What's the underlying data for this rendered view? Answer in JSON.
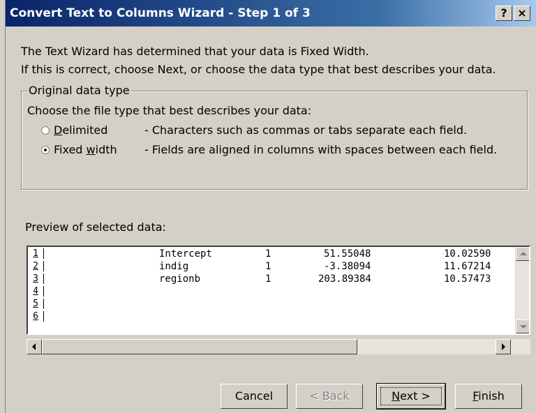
{
  "window": {
    "title": "Convert Text to Columns Wizard - Step 1 of 3",
    "help_label": "?",
    "close_label": "×"
  },
  "intro": {
    "line1": "The Text Wizard has determined that your data is Fixed Width.",
    "line2": "If this is correct, choose Next, or choose the data type that best describes your data."
  },
  "data_type": {
    "group_label": "Original data type",
    "prompt": "Choose the file type that best describes your data:",
    "options": [
      {
        "label_pre": "",
        "label_mnemonic": "D",
        "label_post": "elimited",
        "description": "- Characters such as commas or tabs separate each field.",
        "selected": false
      },
      {
        "label_pre": "Fixed ",
        "label_mnemonic": "w",
        "label_post": "idth",
        "description": "- Fields are aligned in columns with spaces between each field.",
        "selected": true
      }
    ]
  },
  "preview": {
    "label": "Preview of selected data:",
    "row_numbers": [
      "1",
      "2",
      "3",
      "4",
      "5",
      "6"
    ],
    "rows": [
      {
        "name": "Intercept",
        "df": "1",
        "estimate": "51.55048",
        "se": "10.02590"
      },
      {
        "name": "indig",
        "df": "1",
        "estimate": "-3.38094",
        "se": "11.67214"
      },
      {
        "name": "regionb",
        "df": "1",
        "estimate": "203.89384",
        "se": "10.57473"
      }
    ]
  },
  "buttons": {
    "cancel": "Cancel",
    "back": "< Back",
    "next_mnemonic": "N",
    "next_rest": "ext >",
    "finish_mnemonic": "F",
    "finish_rest": "inish"
  }
}
